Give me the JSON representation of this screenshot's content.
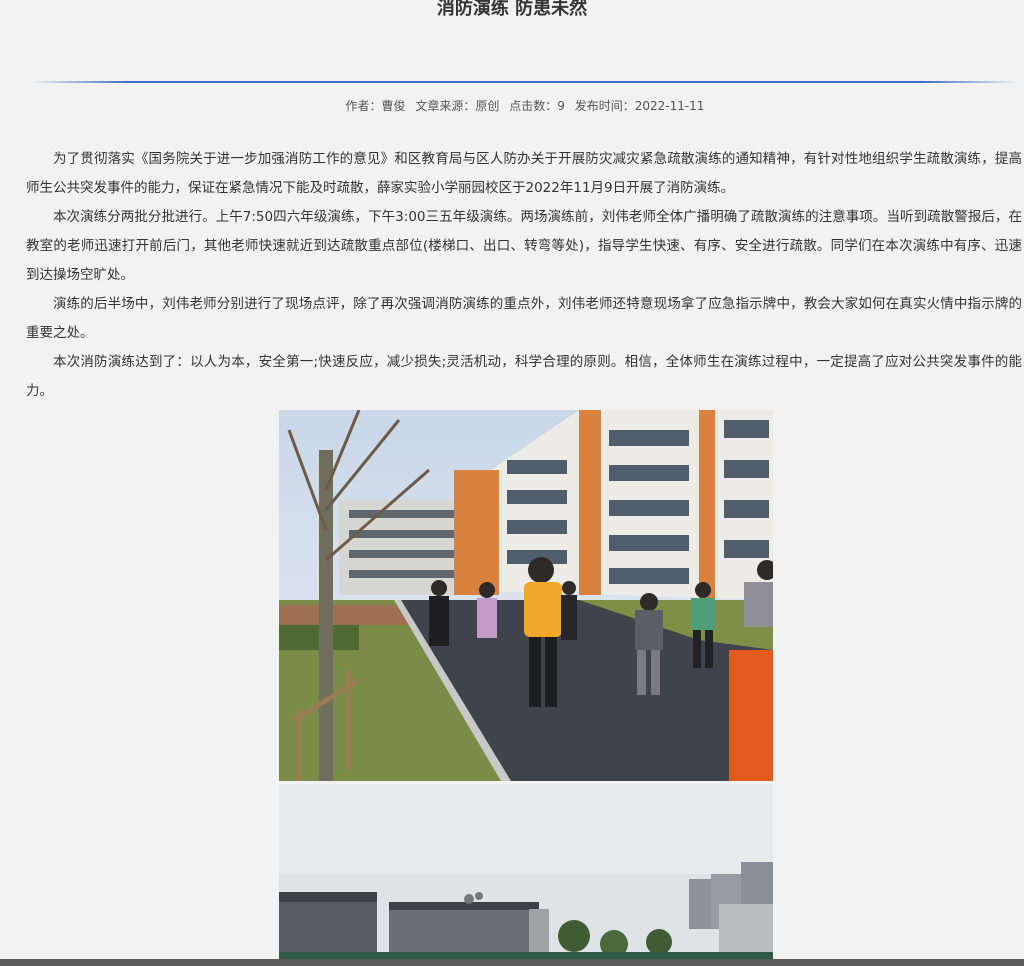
{
  "article": {
    "title": "消防演练 防患未然",
    "meta": {
      "author": "作者：曹俊",
      "source": "文章来源：原创",
      "clicks": "点击数：9",
      "published": "发布时间：2022-11-11"
    },
    "paragraphs": [
      "为了贯彻落实《国务院关于进一步加强消防工作的意见》和区教育局与区人防办关于开展防灾减灾紧急疏散演练的通知精神，有针对性地组织学生疏散演练，提高师生公共突发事件的能力，保证在紧急情况下能及时疏散，薛家实验小学丽园校区于2022年11月9日开展了消防演练。",
      "本次演练分两批分批进行。上午7:50四六年级演练，下午3:00三五年级演练。两场演练前，刘伟老师全体广播明确了疏散演练的注意事项。当听到疏散警报后，在教室的老师迅速打开前后门，其他老师快速就近到达疏散重点部位(楼梯口、出口、转弯等处)，指导学生快速、有序、安全进行疏散。同学们在本次演练中有序、迅速到达操场空旷处。",
      "演练的后半场中，刘伟老师分别进行了现场点评，除了再次强调消防演练的重点外，刘伟老师还特意现场拿了应急指示牌中，教会大家如何在真实火情中指示牌的重要之处。",
      "本次消防演练达到了：以人为本，安全第一;快速反应，减少损失;灵活机动，科学合理的原则。相信，全体师生在演练过程中，一定提高了应对公共突发事件的能力。"
    ]
  },
  "colors": {
    "page_background": "#f2f2f2",
    "divider": "#3a6fc7",
    "text": "#333333"
  }
}
